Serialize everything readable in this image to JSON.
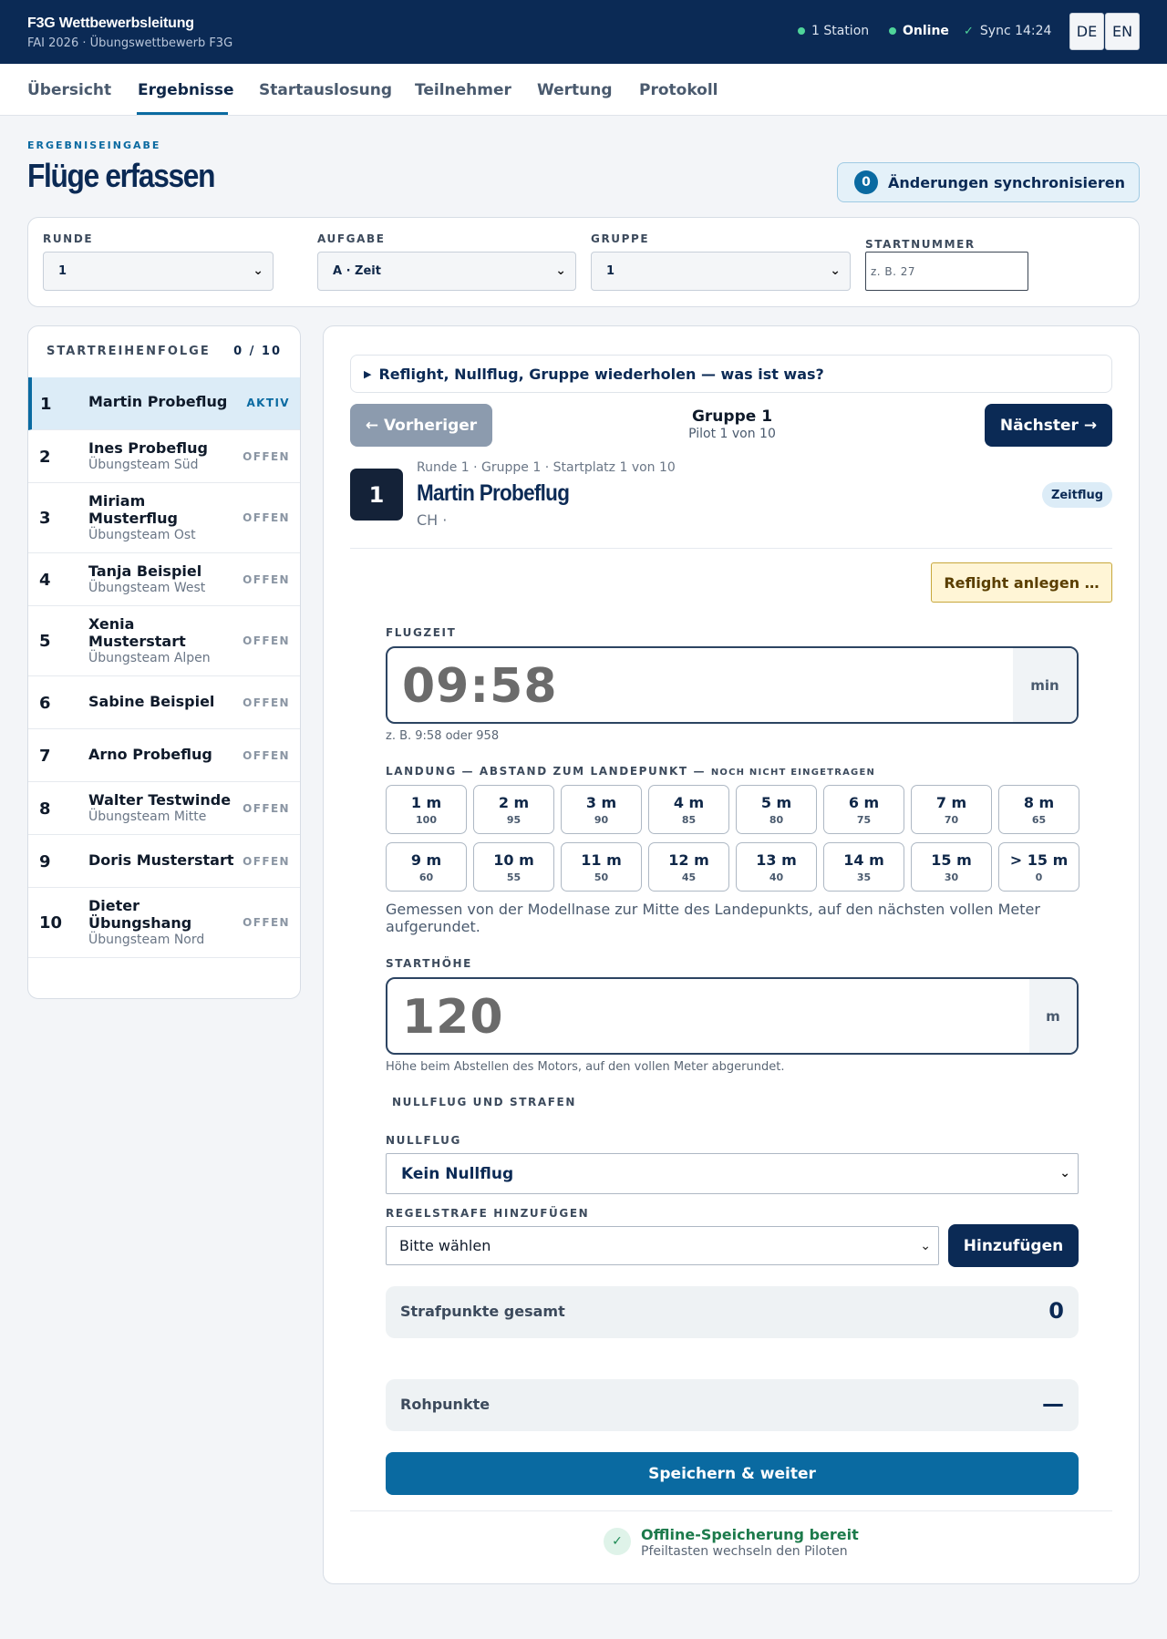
{
  "header": {
    "title": "F3G Wettbewerbsleitung",
    "subtitle": "FAI 2026 · Übungswettbewerb F3G",
    "status_station": "1 Station",
    "status_online": "Online",
    "status_sync": "Sync 14:24",
    "lang_de": "DE",
    "lang_en": "EN",
    "status_color": "#4fd49a"
  },
  "nav": {
    "items": [
      "Übersicht",
      "Ergebnisse",
      "Startauslosung",
      "Teilnehmer",
      "Wertung",
      "Protokoll"
    ],
    "active": "Ergebnisse"
  },
  "page": {
    "eyebrow": "ERGEBNISEINGABE",
    "title": "Flüge erfassen",
    "sync_count": "0",
    "sync_label": "Änderungen synchronisieren"
  },
  "filters": {
    "round_label": "RUNDE",
    "round_value": "1",
    "task_label": "AUFGABE",
    "task_value": "A · Zeit",
    "group_label": "GRUPPE",
    "group_value": "1",
    "start_label": "STARTNUMMER",
    "start_placeholder": "z. B. 27"
  },
  "sidebar": {
    "title": "STARTREIHENFOLGE",
    "count": "0 / 10",
    "pilots": [
      {
        "num": "1",
        "name": "Martin Probeflug",
        "team": "",
        "status": "AKTIV"
      },
      {
        "num": "2",
        "name": "Ines Probeflug",
        "team": "Übungsteam Süd",
        "status": "OFFEN"
      },
      {
        "num": "3",
        "name": "Miriam Musterflug",
        "team": "Übungsteam Ost",
        "status": "OFFEN"
      },
      {
        "num": "4",
        "name": "Tanja Beispiel",
        "team": "Übungsteam West",
        "status": "OFFEN"
      },
      {
        "num": "5",
        "name": "Xenia Musterstart",
        "team": "Übungsteam Alpen",
        "status": "OFFEN"
      },
      {
        "num": "6",
        "name": "Sabine Beispiel",
        "team": "",
        "status": "OFFEN"
      },
      {
        "num": "7",
        "name": "Arno Probeflug",
        "team": "",
        "status": "OFFEN"
      },
      {
        "num": "8",
        "name": "Walter Testwinde",
        "team": "Übungsteam Mitte",
        "status": "OFFEN"
      },
      {
        "num": "9",
        "name": "Doris Musterstart",
        "team": "",
        "status": "OFFEN"
      },
      {
        "num": "10",
        "name": "Dieter Übungshang",
        "team": "Übungsteam Nord",
        "status": "OFFEN"
      }
    ]
  },
  "main": {
    "disclosure": "Reflight, Nullflug, Gruppe wiederholen — was ist was?",
    "prev_label": "← Vorheriger",
    "next_label": "Nächster →",
    "group_title": "Gruppe 1",
    "group_sub": "Pilot 1 von 10",
    "start_no": "1",
    "meta": "Runde 1 · Gruppe 1 · Startplatz 1 von 10",
    "pilot_name": "Martin Probeflug",
    "country": "CH ·",
    "chip": "Zeitflug",
    "reflight_label": "Reflight anlegen …",
    "flight_time_label": "FLUGZEIT",
    "flight_time_value": "09:58",
    "flight_time_unit": "min",
    "flight_time_hint": "z. B. 9:58 oder 958",
    "landing_label": "LANDUNG — ABSTAND ZUM LANDEPUNKT —",
    "landing_note": "NOCH NICHT EINGETRAGEN",
    "landing_options": [
      {
        "dist": "1 m",
        "pts": "100"
      },
      {
        "dist": "2 m",
        "pts": "95"
      },
      {
        "dist": "3 m",
        "pts": "90"
      },
      {
        "dist": "4 m",
        "pts": "85"
      },
      {
        "dist": "5 m",
        "pts": "80"
      },
      {
        "dist": "6 m",
        "pts": "75"
      },
      {
        "dist": "7 m",
        "pts": "70"
      },
      {
        "dist": "8 m",
        "pts": "65"
      },
      {
        "dist": "9 m",
        "pts": "60"
      },
      {
        "dist": "10 m",
        "pts": "55"
      },
      {
        "dist": "11 m",
        "pts": "50"
      },
      {
        "dist": "12 m",
        "pts": "45"
      },
      {
        "dist": "13 m",
        "pts": "40"
      },
      {
        "dist": "14 m",
        "pts": "35"
      },
      {
        "dist": "15 m",
        "pts": "30"
      },
      {
        "dist": "> 15 m",
        "pts": "0"
      }
    ],
    "landing_desc": "Gemessen von der Modellnase zur Mitte des Landepunkts, auf den nächsten vollen Meter aufgerundet.",
    "height_label": "STARTHÖHE",
    "height_value": "120",
    "height_unit": "m",
    "height_hint": "Höhe beim Abstellen des Motors, auf den vollen Meter abgerundet.",
    "penalty_head": "NULLFLUG UND STRAFEN",
    "null_label": "NULLFLUG",
    "null_value": "Kein Nullflug",
    "penalty_label": "REGELSTRAFE HINZUFÜGEN",
    "penalty_value": "Bitte wählen",
    "add_label": "Hinzufügen",
    "penalty_total_label": "Strafpunkte gesamt",
    "penalty_total_value": "0",
    "raw_label": "Rohpunkte",
    "raw_value": "—",
    "save_label": "Speichern & weiter",
    "offline_title": "Offline-Speicherung bereit",
    "offline_sub": "Pfeiltasten wechseln den Piloten"
  }
}
